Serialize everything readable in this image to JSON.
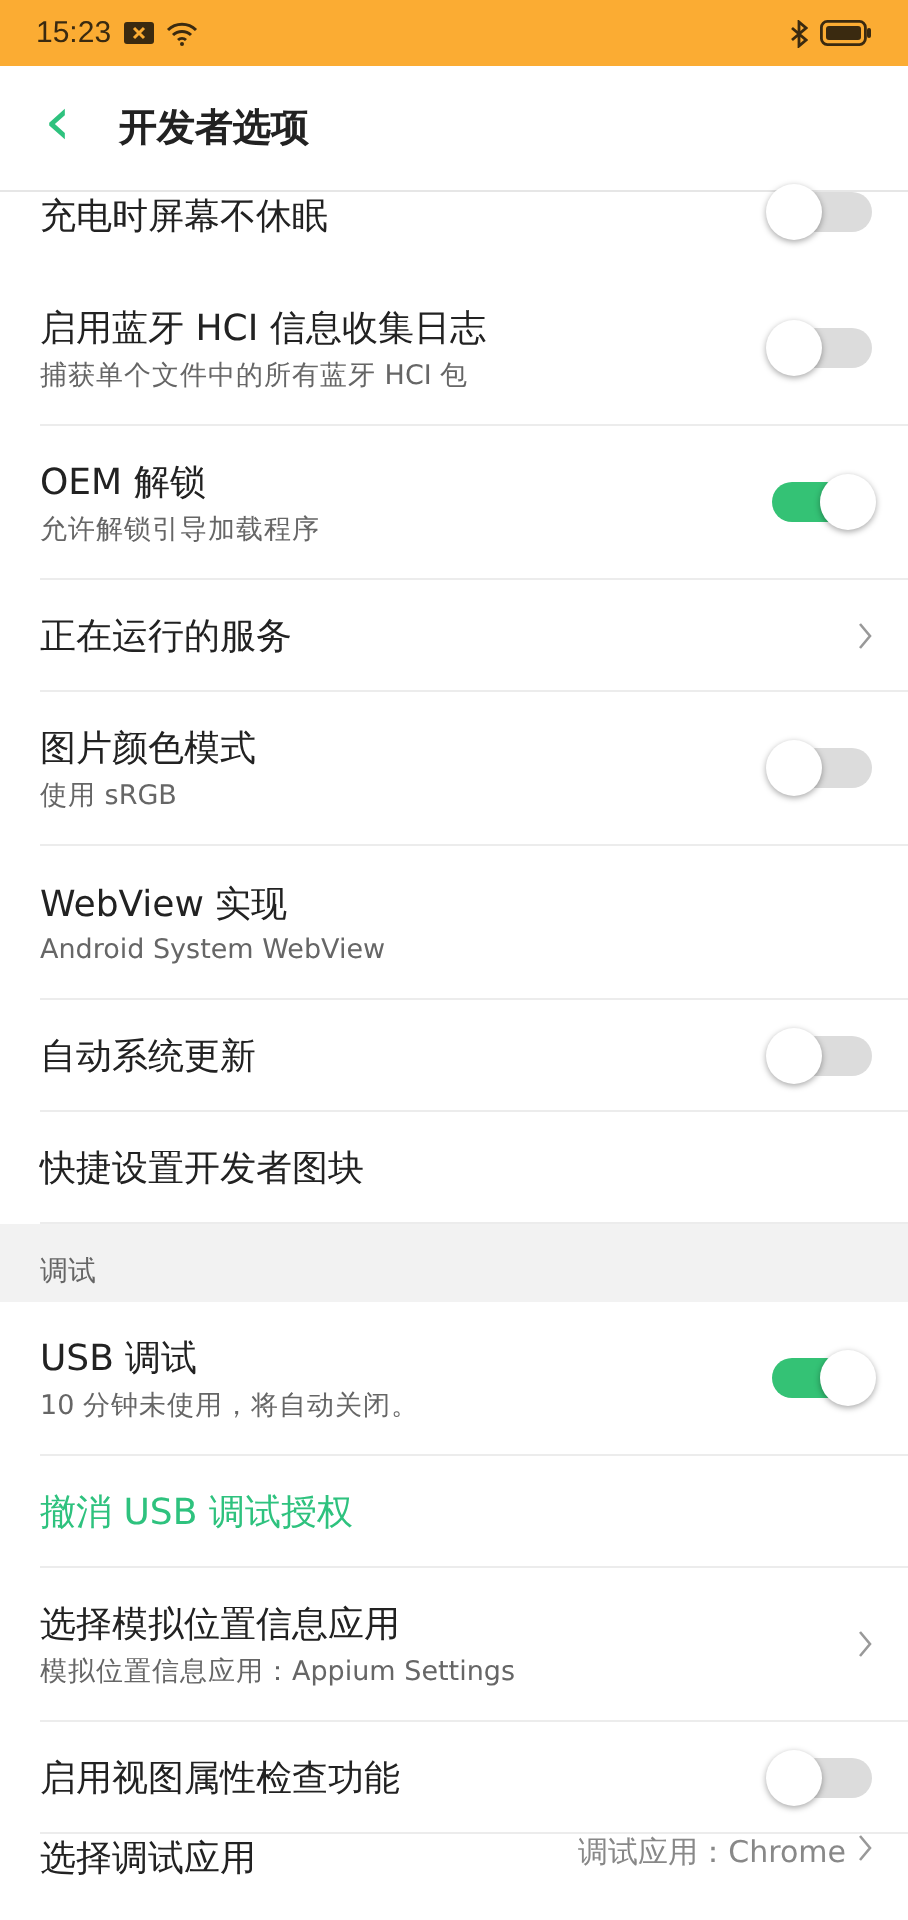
{
  "status_bar": {
    "time": "15:23"
  },
  "header": {
    "back": "‹",
    "title": "开发者选项"
  },
  "items": [
    {
      "kind": "toggle",
      "title": "充电时屏幕不休眠",
      "on": false,
      "clipped": true
    },
    {
      "kind": "toggle",
      "title": "启用蓝牙 HCI 信息收集日志",
      "subtitle": "捕获单个文件中的所有蓝牙 HCI 包",
      "on": false
    },
    {
      "kind": "toggle",
      "title": "OEM 解锁",
      "subtitle": "允许解锁引导加载程序",
      "on": true
    },
    {
      "kind": "link",
      "title": "正在运行的服务"
    },
    {
      "kind": "toggle",
      "title": "图片颜色模式",
      "subtitle": "使用 sRGB",
      "on": false
    },
    {
      "kind": "plain",
      "title": "WebView 实现",
      "subtitle": "Android System WebView"
    },
    {
      "kind": "toggle",
      "title": "自动系统更新",
      "on": false
    },
    {
      "kind": "plain",
      "title": "快捷设置开发者图块"
    },
    {
      "kind": "section",
      "title": "调试"
    },
    {
      "kind": "toggle",
      "title": "USB 调试",
      "subtitle": "10 分钟未使用，将自动关闭。",
      "on": true
    },
    {
      "kind": "action",
      "title": "撤消 USB 调试授权"
    },
    {
      "kind": "link",
      "title": "选择模拟位置信息应用",
      "subtitle": "模拟位置信息应用：Appium Settings"
    },
    {
      "kind": "toggle",
      "title": "启用视图属性检查功能",
      "on": false
    },
    {
      "kind": "link",
      "title": "选择调试应用",
      "value": "调试应用：Chrome",
      "clipped": true
    }
  ]
}
